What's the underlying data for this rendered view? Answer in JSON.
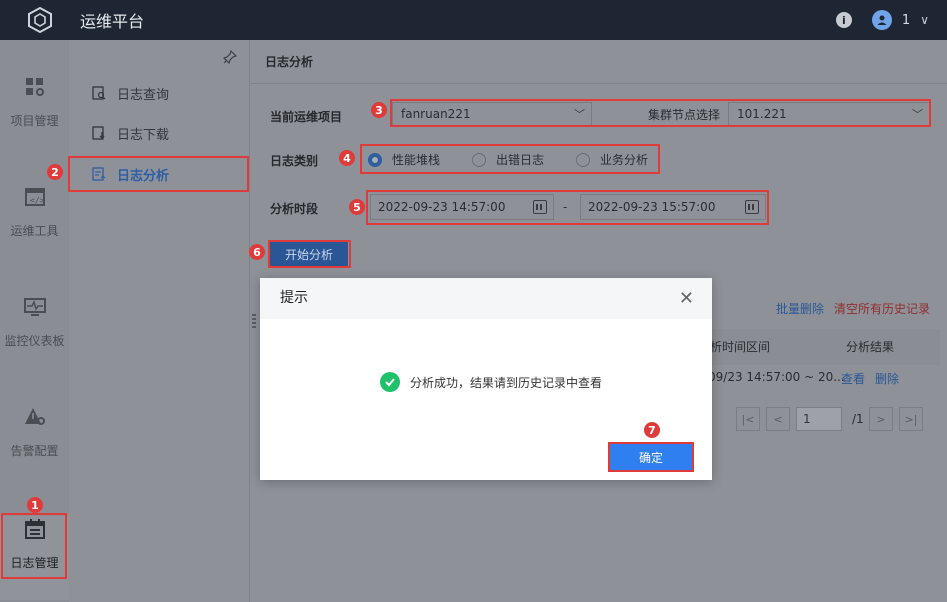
{
  "app": {
    "title": "运维平台",
    "user": "1"
  },
  "rail": [
    {
      "label": "项目管理",
      "icon": "grid-gear-icon"
    },
    {
      "label": "运维工具",
      "icon": "code-window-icon"
    },
    {
      "label": "监控仪表板",
      "icon": "monitor-pulse-icon"
    },
    {
      "label": "告警配置",
      "icon": "warning-gear-icon"
    },
    {
      "label": "日志管理",
      "icon": "calendar-log-icon"
    }
  ],
  "subnav": [
    {
      "label": "日志查询",
      "icon": "log-search-icon"
    },
    {
      "label": "日志下载",
      "icon": "log-download-icon"
    },
    {
      "label": "日志分析",
      "icon": "log-analysis-icon"
    }
  ],
  "page": {
    "title": "日志分析"
  },
  "form": {
    "project_label": "当前运维项目",
    "project_value": "fanruan221",
    "node_label": "集群节点选择",
    "node_value": "101.221",
    "type_label": "日志类别",
    "types": [
      "性能堆栈",
      "出错日志",
      "业务分析"
    ],
    "selected_type_index": 0,
    "period_label": "分析时段",
    "start": "2022-09-23 14:57:00",
    "separator": "-",
    "end": "2022-09-23 15:57:00",
    "start_button": "开始分析"
  },
  "history": {
    "batch_delete": "批量删除",
    "clear_all": "清空所有历史记录",
    "col_range": "析时间区间",
    "col_result": "分析结果",
    "row_range": "09/23 14:57:00 ~ 20...",
    "row_view": "查看",
    "row_delete": "删除",
    "page_current": "1",
    "page_total": "/1"
  },
  "dialog": {
    "title": "提示",
    "message": "分析成功，结果请到历史记录中查看",
    "ok": "确定"
  },
  "markers": [
    "1",
    "2",
    "3",
    "4",
    "5",
    "6",
    "7"
  ],
  "colors": {
    "accent": "#2f7ff0",
    "success": "#1fc26b",
    "annotation": "#e03b3b",
    "topbar": "#1e2633"
  }
}
